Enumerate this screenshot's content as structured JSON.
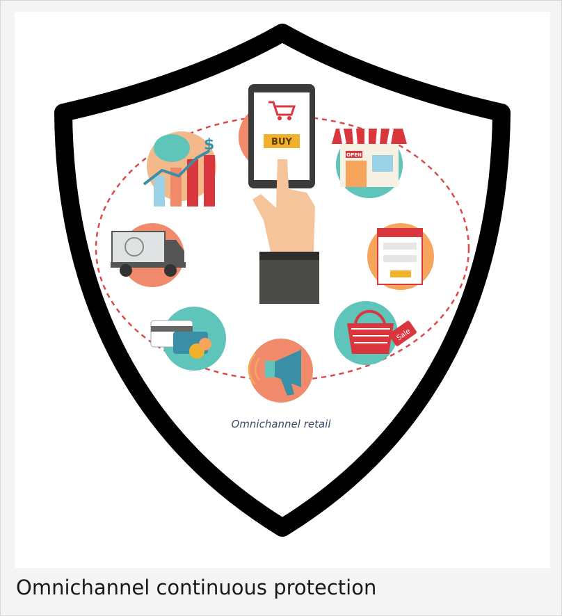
{
  "figure": {
    "inner_label": "Omnichannel retail",
    "buy_label": "BUY",
    "open_sign": "OPEN",
    "sale_tag": "Sale",
    "icons": [
      "smartphone-buy-icon",
      "storefront-icon",
      "web-form-icon",
      "shopping-basket-icon",
      "megaphone-icon",
      "credit-cards-coins-icon",
      "delivery-truck-icon",
      "piggy-bank-growth-chart-icon"
    ],
    "colors": {
      "shield": "#000000",
      "salmon": "#f08a6a",
      "teal": "#5fc4b9",
      "orange": "#f7a45c",
      "peach": "#f4b98a",
      "red": "#d9363e",
      "dash": "#d94b4b"
    }
  },
  "caption": "Omnichannel continuous protection"
}
